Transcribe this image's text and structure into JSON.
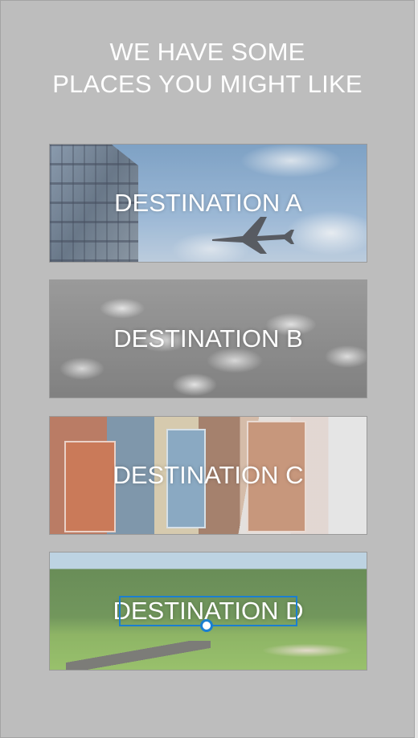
{
  "headline": {
    "line1": "WE HAVE SOME",
    "line2": "PLACES YOU MIGHT LIKE"
  },
  "destinations": [
    {
      "label": "DESTINATION A",
      "image": "airplane-sky-building"
    },
    {
      "label": "DESTINATION B",
      "image": "typewriter-keys"
    },
    {
      "label": "DESTINATION C",
      "image": "hanging-postcards"
    },
    {
      "label": "DESTINATION D",
      "image": "park-landscape"
    }
  ],
  "selection": {
    "target": "DESTINATION D",
    "color": "#1a7fd0"
  },
  "colors": {
    "background": "#bdbdbd",
    "text": "#ffffff"
  }
}
